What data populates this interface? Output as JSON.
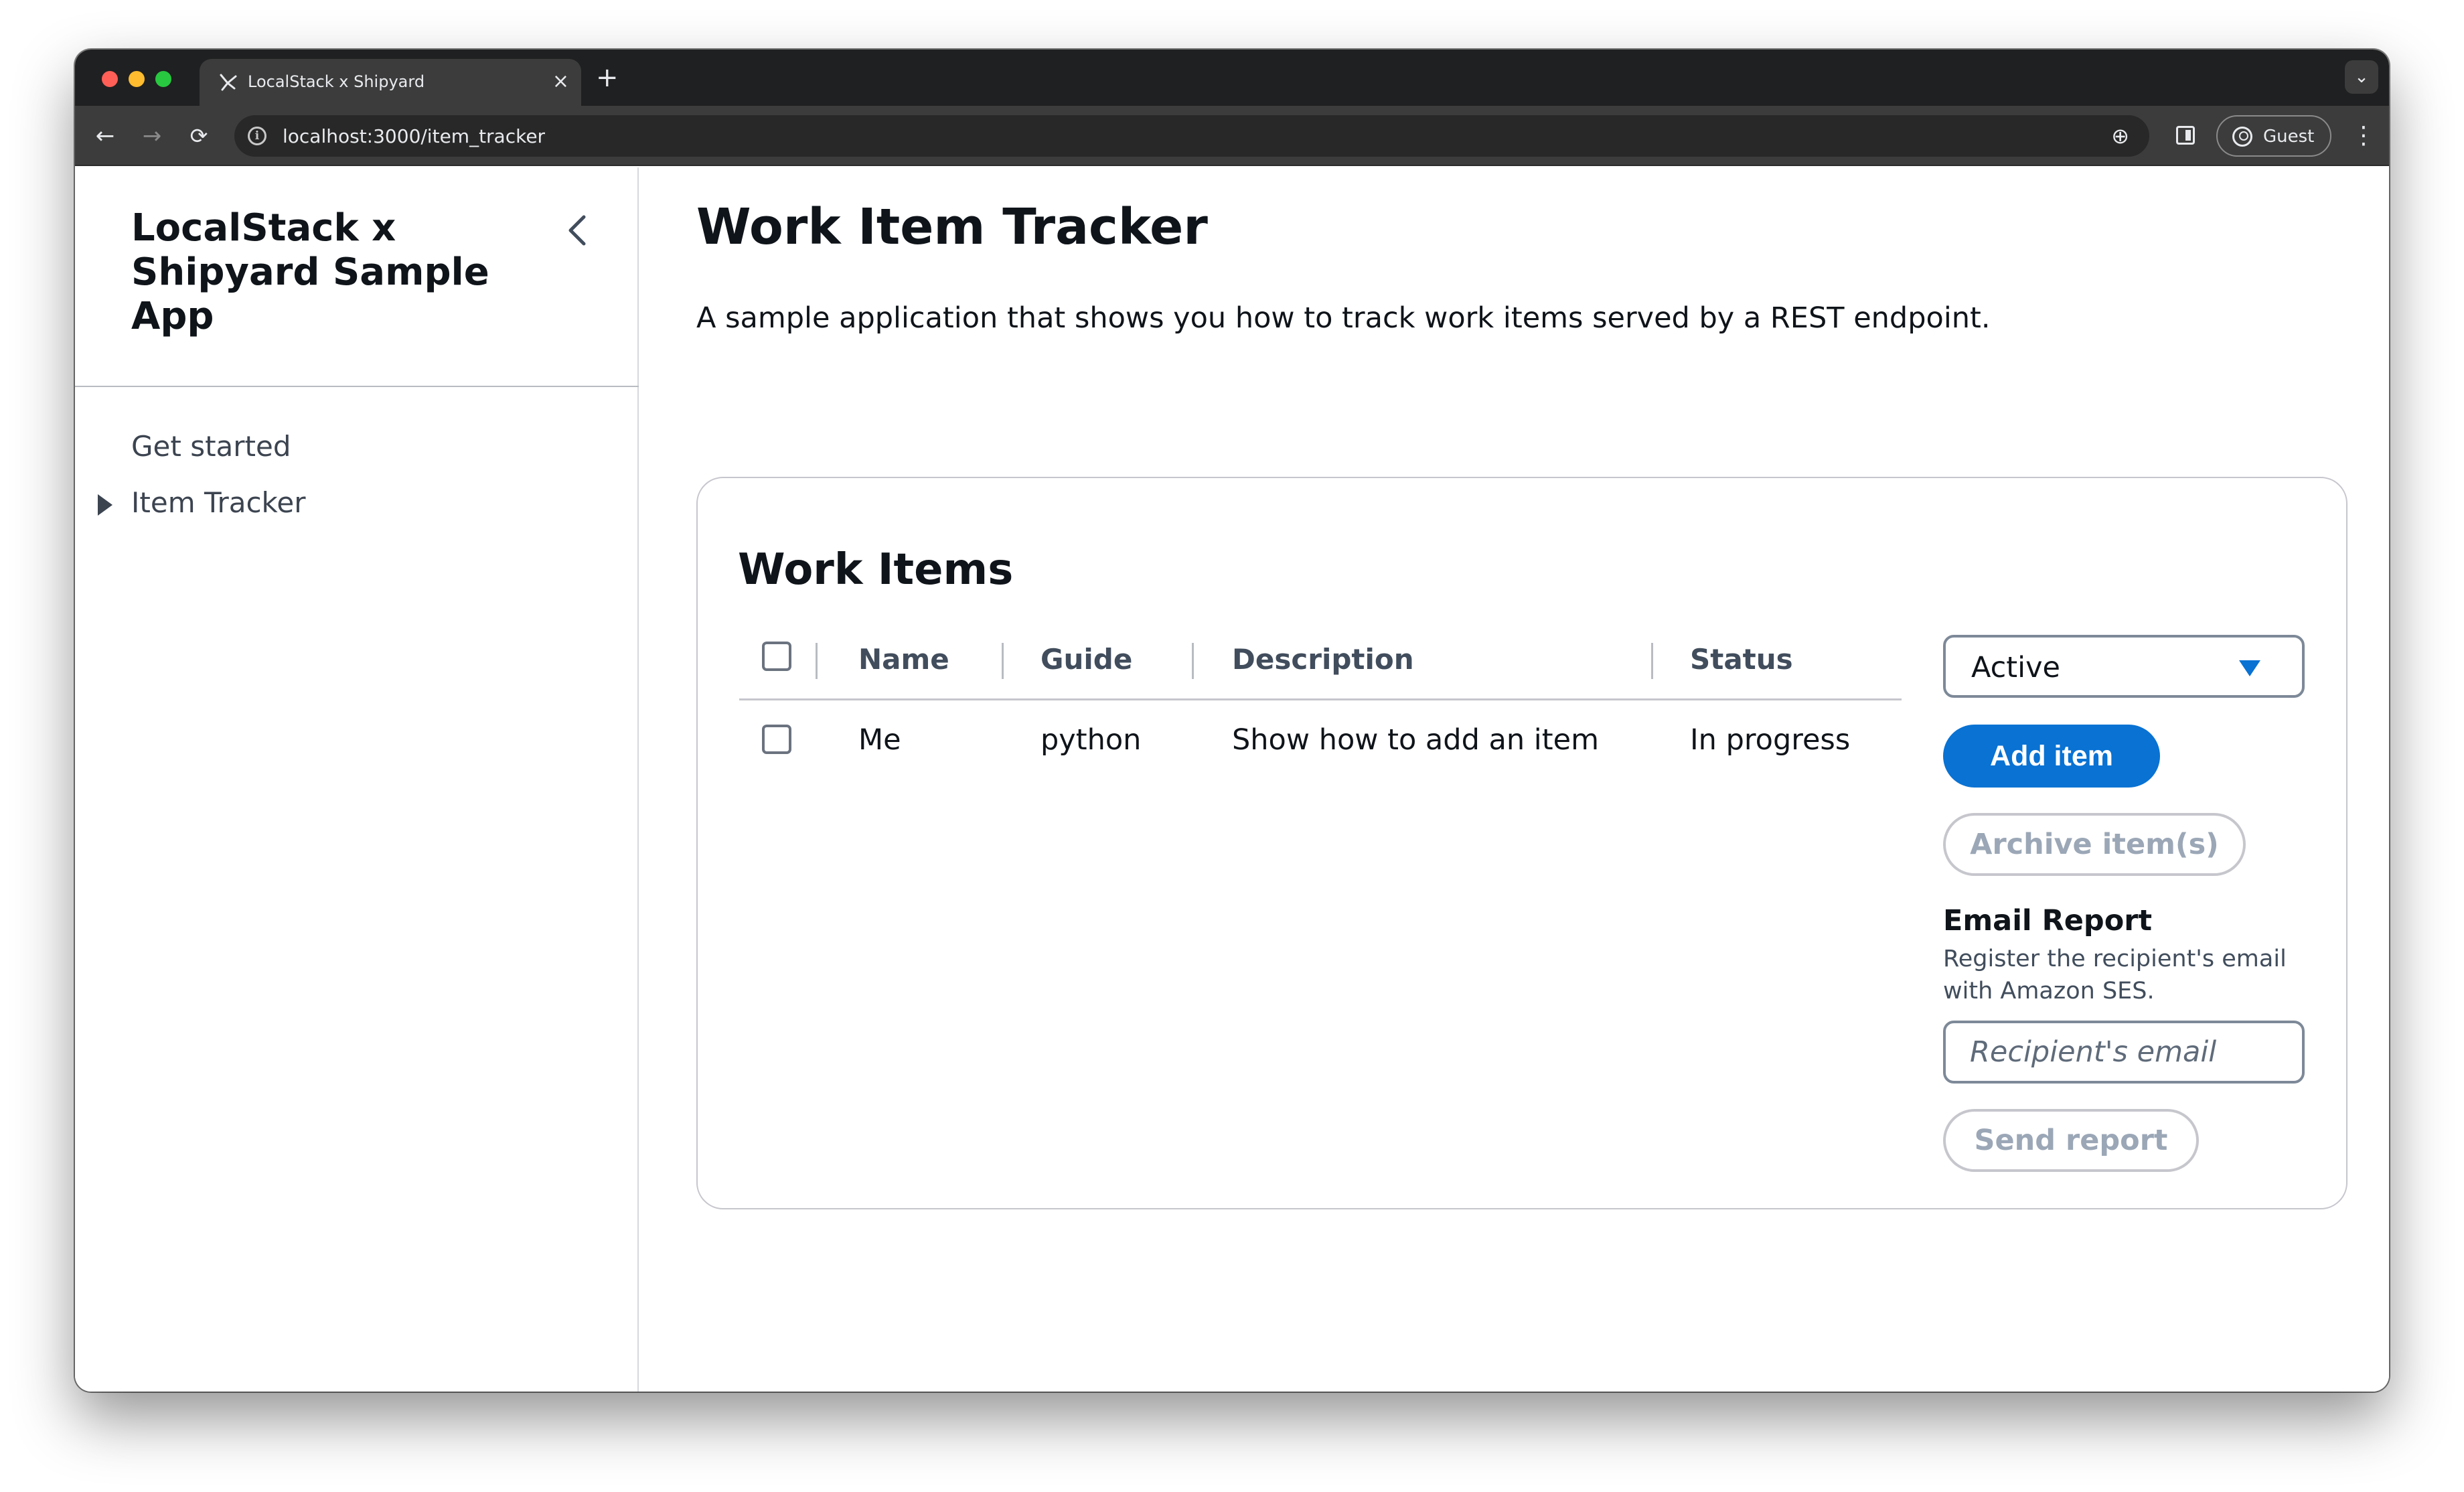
{
  "browser": {
    "tab_title": "LocalStack x Shipyard",
    "tab_close": "×",
    "new_tab": "+",
    "tab_menu": "⌄",
    "nav_back": "←",
    "nav_forward": "→",
    "nav_reload": "⟳",
    "info_glyph": "i",
    "url": "localhost:3000/item_tracker",
    "zoom_glyph": "⊕",
    "profile_label": "Guest",
    "menu_glyph": "⋮"
  },
  "sidebar": {
    "title": "LocalStack x Shipyard Sample App",
    "items": [
      {
        "label": "Get started"
      },
      {
        "label": "Item Tracker"
      }
    ]
  },
  "main": {
    "title": "Work Item Tracker",
    "description": "A sample application that shows you how to track work items served by a REST endpoint."
  },
  "work_items": {
    "title": "Work Items",
    "columns": [
      "Name",
      "Guide",
      "Description",
      "Status"
    ],
    "rows": [
      {
        "name": "Me",
        "guide": "python",
        "description": "Show how to add an item",
        "status": "In progress"
      }
    ],
    "filter": {
      "selected": "Active"
    },
    "add_label": "Add item",
    "archive_label": "Archive item(s)"
  },
  "email_report": {
    "title": "Email Report",
    "description": "Register the recipient's email with Amazon SES.",
    "placeholder": "Recipient's email",
    "send_label": "Send report"
  },
  "colors": {
    "accent": "#0972d3",
    "text": "#0f141a",
    "disabled": "#9ba7b6",
    "chrome_bg": "#3c3c3c"
  }
}
